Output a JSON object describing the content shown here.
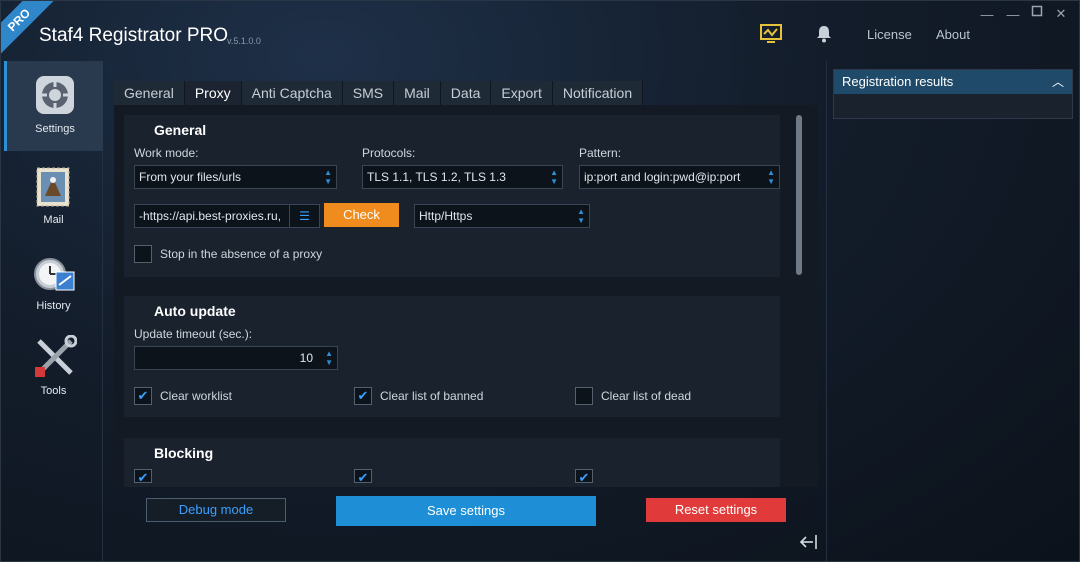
{
  "header": {
    "badge": "PRO",
    "title": "Staf4 Registrator PRO",
    "version": "v.5.1.0.0",
    "license": "License",
    "about": "About"
  },
  "window": {
    "minimize": "—",
    "restore": "▫",
    "close": "✕",
    "minimize2": "—"
  },
  "sidebar": {
    "items": [
      {
        "label": "Settings"
      },
      {
        "label": "Mail"
      },
      {
        "label": "History"
      },
      {
        "label": "Tools"
      }
    ]
  },
  "tabs": [
    "General",
    "Proxy",
    "Anti Captcha",
    "SMS",
    "Mail",
    "Data",
    "Export",
    "Notification"
  ],
  "general": {
    "title": "General",
    "work_mode_label": "Work mode:",
    "work_mode_value": "From your files/urls",
    "protocols_label": "Protocols:",
    "protocols_value": "TLS 1.1, TLS 1.2, TLS 1.3",
    "pattern_label": "Pattern:",
    "pattern_value": "ip:port  and  login:pwd@ip:port",
    "source_value": "-https://api.best-proxies.ru,",
    "check_button": "Check",
    "type_value": "Http/Https",
    "stop_label": "Stop in the absence of a proxy"
  },
  "auto_update": {
    "title": "Auto update",
    "timeout_label": "Update timeout (sec.):",
    "timeout_value": "10",
    "clear_worklist": "Clear worklist",
    "clear_banned": "Clear list of banned",
    "clear_dead": "Clear list of dead"
  },
  "blocking": {
    "title": "Blocking"
  },
  "footer": {
    "debug": "Debug mode",
    "save": "Save settings",
    "reset": "Reset settings"
  },
  "right_panel": {
    "title": "Registration results"
  },
  "colors": {
    "accent": "#2d8fd6",
    "check": "#f08c1e",
    "save": "#1e8fd6",
    "reset": "#e03a3a"
  }
}
